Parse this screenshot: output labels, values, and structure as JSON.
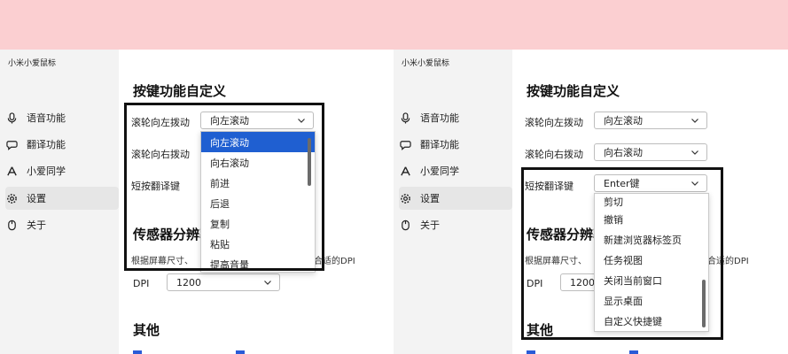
{
  "app_title": "小米小爱鼠标",
  "nav": [
    {
      "label": "语音功能",
      "icon": "microphone-icon"
    },
    {
      "label": "翻译功能",
      "icon": "chat-bubble-icon"
    },
    {
      "label": "小爱同学",
      "icon": "xiaoai-icon"
    },
    {
      "label": "设置",
      "icon": "gear-icon",
      "active": true
    },
    {
      "label": "关于",
      "icon": "mouse-icon"
    }
  ],
  "section_title": "按键功能自定义",
  "rows": [
    {
      "label": "滚轮向左拨动",
      "value": "向左滚动"
    },
    {
      "label": "滚轮向右拨动",
      "value": "向右滚动"
    },
    {
      "label": "短按翻译键",
      "value": "Enter键"
    }
  ],
  "sensor_title": "传感器分辨率",
  "sensor_desc_left": "根据屏幕尺寸、",
  "sensor_desc_right": "合适的DPI",
  "dpi_label": "DPI",
  "dpi_value": "1200",
  "other_title": "其他",
  "left_dropdown": [
    "向左滚动",
    "向右滚动",
    "前进",
    "后退",
    "复制",
    "粘贴",
    "提高音量"
  ],
  "right_dropdown": [
    "剪切",
    "撤销",
    "新建浏览器标签页",
    "任务视图",
    "关闭当前窗口",
    "显示桌面",
    "自定义快捷键"
  ],
  "colors": {
    "banner": "#fbcfd1",
    "sidebar": "#f3f3f3",
    "selected": "#1f5fd1",
    "highlight": "#111111"
  }
}
